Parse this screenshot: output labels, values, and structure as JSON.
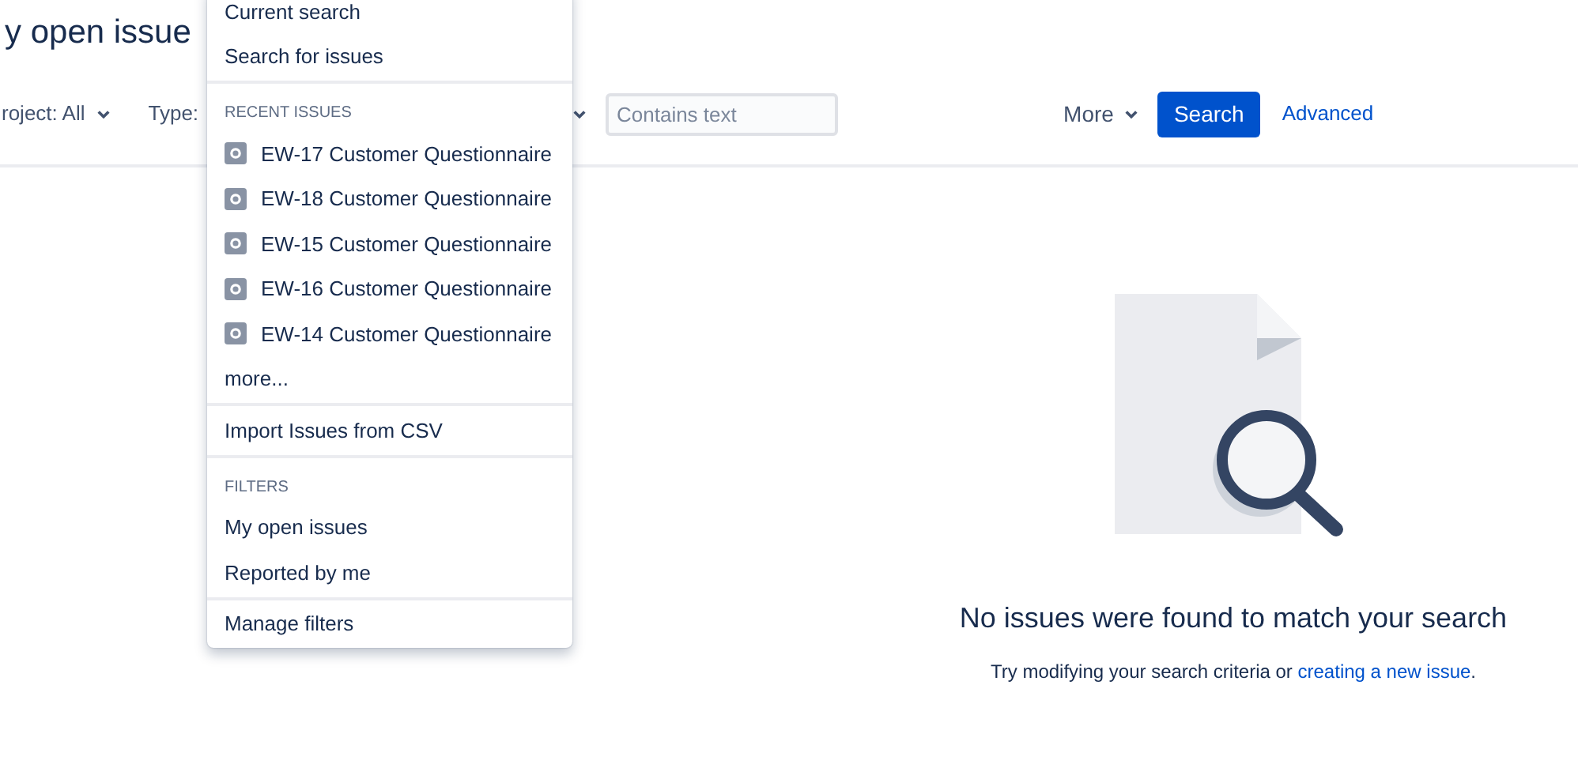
{
  "page": {
    "title": "y open issue"
  },
  "filters": [
    {
      "label": "roject: All"
    },
    {
      "label": "Type:"
    }
  ],
  "search_field": {
    "placeholder": "Contains text"
  },
  "more_button": "More",
  "search_button": "Search",
  "advanced_link": "Advanced",
  "menu": {
    "sections": [
      {
        "items": [
          {
            "label": "Current search",
            "kind": "text"
          },
          {
            "label": "Search for issues",
            "kind": "text"
          }
        ]
      },
      {
        "heading": "RECENT ISSUES",
        "items": [
          {
            "label": "EW-17 Customer Questionnaire",
            "kind": "issue"
          },
          {
            "label": "EW-18 Customer Questionnaire",
            "kind": "issue"
          },
          {
            "label": "EW-15 Customer Questionnaire",
            "kind": "issue"
          },
          {
            "label": "EW-16 Customer Questionnaire",
            "kind": "issue"
          },
          {
            "label": "EW-14 Customer Questionnaire",
            "kind": "issue"
          },
          {
            "label": "more...",
            "kind": "text"
          }
        ]
      },
      {
        "items": [
          {
            "label": "Import Issues from CSV",
            "kind": "text"
          }
        ]
      },
      {
        "heading": "FILTERS",
        "items": [
          {
            "label": "My open issues",
            "kind": "text"
          },
          {
            "label": "Reported by me",
            "kind": "text"
          }
        ]
      },
      {
        "items": [
          {
            "label": "Manage filters",
            "kind": "text"
          }
        ]
      }
    ]
  },
  "empty_state": {
    "title": "No issues were found to match your search",
    "message": "Try modifying your search criteria or",
    "link": "creating a new issue",
    "after": "."
  }
}
